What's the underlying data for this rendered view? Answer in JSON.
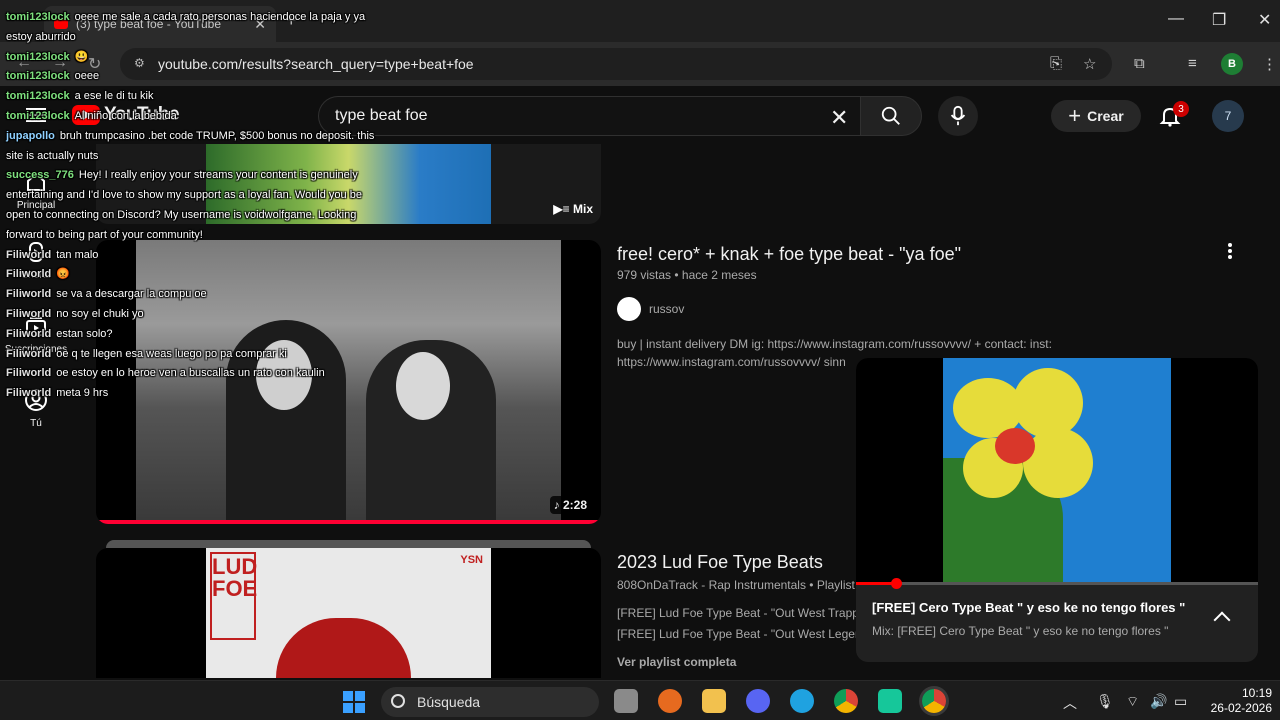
{
  "browser": {
    "tab_title": "(3) type beat foe - YouTube",
    "tab_close": "✕",
    "new_tab": "+",
    "url": "youtube.com/results?search_query=type+beat+foe",
    "profile_initial": "B",
    "window_controls": [
      "—",
      "❐",
      "✕"
    ]
  },
  "youtube": {
    "logo_text": "YouTube",
    "search_query": "type beat foe",
    "create_label": "Crear",
    "notif_count": "3",
    "user_initial": "7",
    "sidebar": [
      {
        "label": "Principal",
        "icon": "home-icon"
      },
      {
        "label": "Shorts",
        "icon": "shorts-icon"
      },
      {
        "label": "Suscripciones",
        "icon": "subscriptions-icon"
      },
      {
        "label": "Tú",
        "icon": "user-icon"
      }
    ]
  },
  "results": {
    "top_mix_label": "Mix",
    "video1": {
      "title": "free! cero* + knak + foe type beat - \"ya foe\"",
      "meta": "979 vistas • hace 2 meses",
      "channel": "russov",
      "desc1": "buy | instant delivery DM ig: https://www.instagram.com/russovvvv/ + contact: inst:",
      "desc2": "https://www.instagram.com/russovvvv/ sinn",
      "duration": "2:28"
    },
    "playlist": {
      "title": "2023 Lud Foe Type Beats",
      "meta": "808OnDaTrack - Rap Instrumentals • Playlist",
      "item1": "[FREE] Lud Foe Type Beat - \"Out West Trappin",
      "item2": "[FREE] Lud Foe Type Beat - \"Out West Legend",
      "link": "Ver playlist completa",
      "art_text": "LUD FOE",
      "art_badge": "YSN"
    }
  },
  "miniplayer": {
    "title": "[FREE] Cero Type Beat \" y eso ke no tengo flores \"",
    "subtitle": "Mix: [FREE] Cero Type Beat \" y eso ke no tengo flores \"",
    "progress_fraction": 0.1
  },
  "chat": [
    {
      "user": "tomi123lock",
      "msg": "oeee me sale a cada rato personas haciendoce la paja y ya estoy aburrido"
    },
    {
      "user": "tomi123lock",
      "msg": "😃"
    },
    {
      "user": "tomi123lock",
      "msg": "oeee"
    },
    {
      "user": "tomi123lock",
      "msg": "a ese le di tu kik"
    },
    {
      "user": "tomi123lock",
      "msg": "Al niño con la bebida"
    },
    {
      "user": "jupapollo",
      "msg": "bruh trumpcasino .bet code TRUMP, $500 bonus no deposit. this site is actually nuts"
    },
    {
      "user": "success_776",
      "msg": "Hey! I really enjoy your streams your content is genuinely entertaining and I'd love to show my support as a loyal fan. Would you be open to connecting on Discord? My username is voidwolfgame. Looking forward to being part of your community!"
    },
    {
      "user": "Filiworld",
      "msg": "tan malo"
    },
    {
      "user": "Filiworld",
      "msg": "😡"
    },
    {
      "user": "Filiworld",
      "msg": "se va a descargar la compu oe"
    },
    {
      "user": "Filiworld",
      "msg": "no soy el chuki yo"
    },
    {
      "user": "Filiworld",
      "msg": "estan solo?"
    },
    {
      "user": "Filiworld",
      "msg": "oe q te llegen esa weas luego po pa comprar ki"
    },
    {
      "user": "Filiworld",
      "msg": "oe estoy en lo heroe ven a buscallas un rato con kaulin"
    },
    {
      "user": "Filiworld",
      "msg": "meta 9 hrs"
    }
  ],
  "taskbar": {
    "search_placeholder": "Búsqueda",
    "time": "10:19",
    "date": "26-02-2026"
  }
}
